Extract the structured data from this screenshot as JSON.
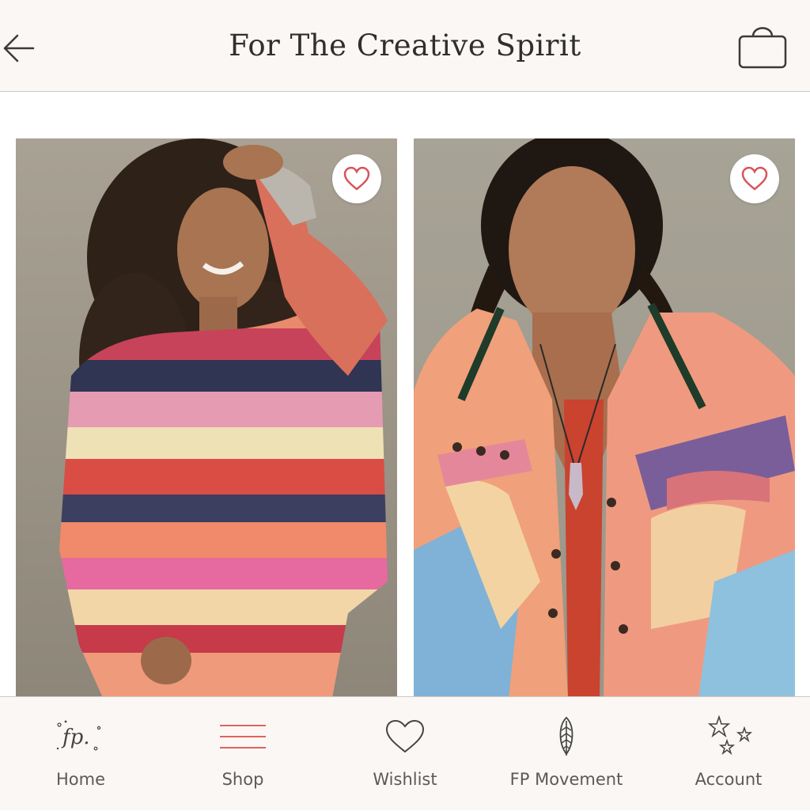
{
  "header": {
    "title": "For The Creative Spirit",
    "back_icon": "arrow-left-icon",
    "bag_icon": "shopping-bag-icon"
  },
  "products": [
    {
      "favorite_icon": "heart-outline-icon"
    },
    {
      "favorite_icon": "heart-outline-icon"
    }
  ],
  "tabs": [
    {
      "label": "Home",
      "icon": "fp-logo-icon"
    },
    {
      "label": "Shop",
      "icon": "menu-lines-icon",
      "color": "#e0635f"
    },
    {
      "label": "Wishlist",
      "icon": "heart-icon"
    },
    {
      "label": "FP Movement",
      "icon": "feather-icon"
    },
    {
      "label": "Account",
      "icon": "stars-icon"
    }
  ],
  "colors": {
    "header_bg": "#fbf7f4",
    "accent": "#e0635f",
    "heart": "#d9535a",
    "text": "#3a3a3a"
  }
}
